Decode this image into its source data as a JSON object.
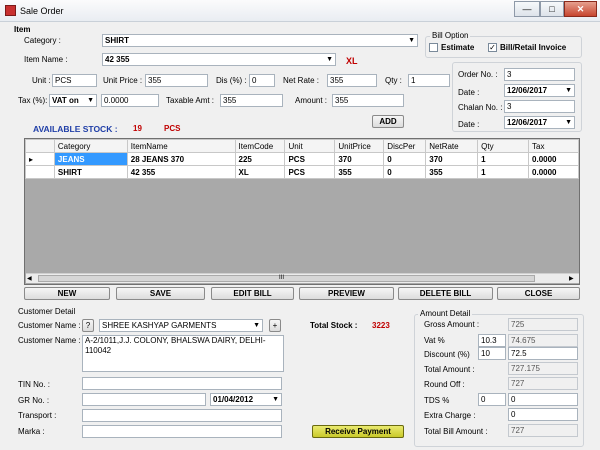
{
  "window": {
    "title": "Sale Order",
    "minimize": "—",
    "maximize": "□",
    "close": "✕"
  },
  "item": {
    "group_label": "Item",
    "category_label": "Category :",
    "category_value": "SHIRT",
    "item_name_label": "Item Name :",
    "item_name_value": "42 355",
    "size_badge": "XL",
    "unit_label": "Unit :",
    "unit_value": "PCS",
    "unit_price_label": "Unit Price :",
    "unit_price_value": "355",
    "dis_label": "Dis (%) :",
    "dis_value": "0",
    "net_rate_label": "Net Rate :",
    "net_rate_value": "355",
    "qty_label": "Qty :",
    "qty_value": "1",
    "tax_label": "Tax (%):",
    "tax_type_value": "VAT on",
    "tax_value": "0.0000",
    "taxable_amt_label": "Taxable Amt :",
    "taxable_amt_value": "355",
    "amount_label": "Amount :",
    "amount_value": "355",
    "add_button": "ADD",
    "available_stock_label": "AVAILABLE STOCK :",
    "available_stock_qty": "19",
    "available_stock_unit": "PCS"
  },
  "bill_option": {
    "label": "Bill Option",
    "estimate_label": "Estimate",
    "estimate_checked": false,
    "bill_retail_label": "Bill/Retail Invoice",
    "bill_retail_checked": true
  },
  "order": {
    "order_no_label": "Order No. :",
    "order_no_value": "3",
    "date1_label": "Date :",
    "date1_value": "12/06/2017",
    "chalan_no_label": "Chalan No. :",
    "chalan_no_value": "3",
    "date2_label": "Date :",
    "date2_value": "12/06/2017"
  },
  "grid": {
    "columns": [
      "Category",
      "ItemName",
      "ItemCode",
      "Unit",
      "UnitPrice",
      "DiscPer",
      "NetRate",
      "Qty",
      "Tax"
    ],
    "rows": [
      [
        "JEANS",
        "28 JEANS 370",
        "225",
        "PCS",
        "370",
        "0",
        "370",
        "1",
        "0.0000"
      ],
      [
        "SHIRT",
        "42 355",
        "XL",
        "PCS",
        "355",
        "0",
        "355",
        "1",
        "0.0000"
      ]
    ],
    "row_marker": "▸",
    "scroll_grip": "III"
  },
  "actions": {
    "new": "NEW",
    "save": "SAVE",
    "edit_bill": "EDIT BILL",
    "preview": "PREVIEW",
    "delete_bill": "DELETE BILL",
    "close": "CLOSE"
  },
  "customer": {
    "group_label": "Customer Detail",
    "name_label": "Customer Name :",
    "help_button": "?",
    "name_value": "SHREE KASHYAP GARMENTS",
    "add_button": "+",
    "address_label": "Customer Name :",
    "address_value": "A-2/1011,J.J. COLONY, BHALSWA DAIRY, DELHI-110042",
    "tin_label": "TIN No. :",
    "tin_value": "",
    "gr_label": "GR No. :",
    "gr_value": "",
    "gr_date_value": "01/04/2012",
    "transport_label": "Transport :",
    "transport_value": "",
    "marka_label": "Marka :",
    "marka_value": "",
    "total_stock_label": "Total Stock :",
    "total_stock_value": "3223",
    "receive_payment": "Receive Payment"
  },
  "amount": {
    "group_label": "Amount Detail",
    "gross_label": "Gross Amount :",
    "gross_value": "725",
    "vat_label": "Vat %",
    "vat_pct": "10.3",
    "vat_value": "74.675",
    "discount_label": "Discount (%)",
    "discount_pct": "10",
    "discount_value": "72.5",
    "total_label": "Total Amount :",
    "total_value": "727.175",
    "roundoff_label": "Round Off :",
    "roundoff_value": "727",
    "tds_label": "TDS %",
    "tds_pct": "0",
    "tds_value": "0",
    "extra_label": "Extra Charge :",
    "extra_value": "0",
    "total_bill_label": "Total Bill Amount :",
    "total_bill_value": "727"
  }
}
